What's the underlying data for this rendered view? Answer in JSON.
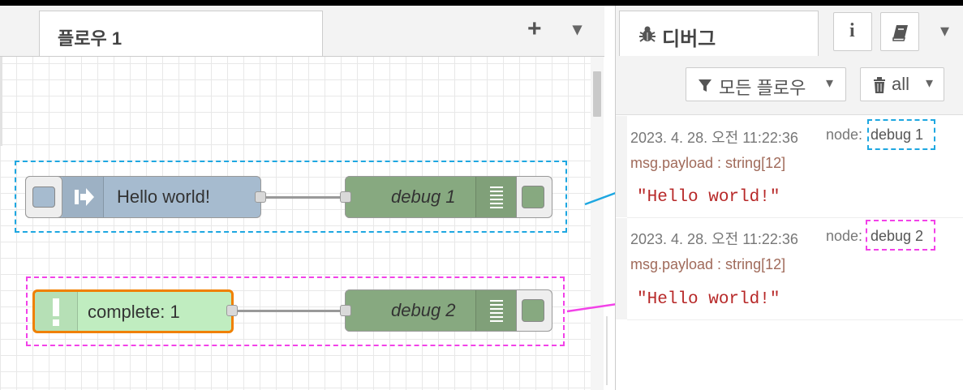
{
  "workspace": {
    "tab_label": "플로우 1",
    "add_label": "+",
    "menu_label": "▾"
  },
  "flow": {
    "inject_node": {
      "label": "Hello world!",
      "color": "#a6bbcf"
    },
    "debug_node_1": {
      "label": "debug 1",
      "color": "#87a980"
    },
    "complete_node": {
      "label": "complete: 1",
      "color": "#c0edc0",
      "border": "#f08000"
    },
    "debug_node_2": {
      "label": "debug 2",
      "color": "#87a980"
    }
  },
  "sidebar": {
    "tab_label": "디버그",
    "info_label": "i",
    "filter_label": "모든 플로우",
    "clear_label": "all",
    "menu_label": "▾"
  },
  "messages": [
    {
      "timestamp": "2023. 4. 28. 오전 11:22:36",
      "node_prefix": "node:",
      "node": "debug 1",
      "topic": "msg.payload : string[12]",
      "value": "\"Hello world!\""
    },
    {
      "timestamp": "2023. 4. 28. 오전 11:22:36",
      "node_prefix": "node:",
      "node": "debug 2",
      "topic": "msg.payload : string[12]",
      "value": "\"Hello world!\""
    }
  ],
  "colors": {
    "highlight_blue": "#1ea7e1",
    "highlight_pink": "#f242e8"
  }
}
